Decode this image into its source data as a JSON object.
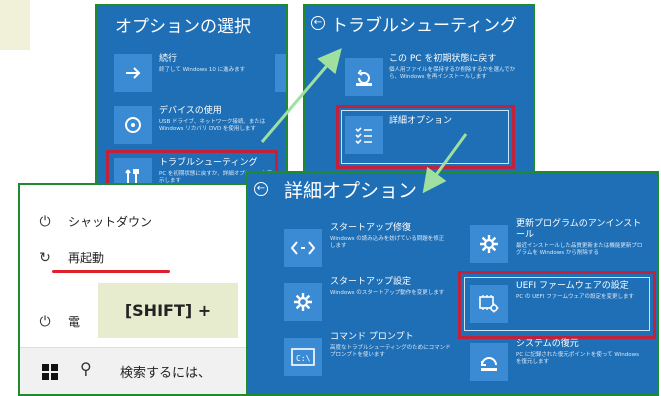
{
  "panel_options": {
    "title": "オプションの選択",
    "items": [
      {
        "label": "続行",
        "desc": "終了して Windows 10 に進みます",
        "icon": "arrow-right-icon"
      },
      {
        "label": "デバイスの使用",
        "desc": "USB ドライブ、ネットワーク接続、または Windows リカバリ DVD を使用します",
        "icon": "disc-icon"
      },
      {
        "label": "トラブルシューティング",
        "desc": "PC を初期状態に戻すか、詳細オプションを表示します",
        "icon": "tools-icon"
      }
    ]
  },
  "panel_troubleshoot": {
    "title": "トラブルシューティング",
    "items": [
      {
        "label": "この PC を初期状態に戻す",
        "desc": "個人用ファイルを保持するか削除するかを選んでから、Windows を再インストールします",
        "icon": "reset-icon"
      },
      {
        "label": "詳細オプション",
        "desc": "",
        "icon": "checklist-icon"
      }
    ]
  },
  "panel_advanced": {
    "title": "詳細オプション",
    "left": [
      {
        "label": "スタートアップ修復",
        "desc": "Windows の読み込みを妨げている問題を修正します",
        "icon": "code-icon"
      },
      {
        "label": "スタートアップ設定",
        "desc": "Windows のスタートアップ動作を変更します",
        "icon": "gear-icon"
      },
      {
        "label": "コマンド プロンプト",
        "desc": "高度なトラブルシューティングのためにコマンド プロンプトを使います",
        "icon": "cmd-icon"
      }
    ],
    "right": [
      {
        "label": "更新プログラムのアンインストール",
        "desc": "最近インストールした品質更新または機能更新プログラムを Windows から削除する",
        "icon": "gear-icon"
      },
      {
        "label": "UEFI ファームウェアの設定",
        "desc": "PC の UEFI ファームウェアの設定を変更します",
        "icon": "chip-gear-icon"
      },
      {
        "label": "システムの復元",
        "desc": "PC に記録された復元ポイントを使って Windows を復元します",
        "icon": "restore-icon"
      }
    ]
  },
  "start_menu": {
    "shutdown_label": "シャットダウン",
    "restart_label": "再起動",
    "power_label": "電",
    "search_placeholder": "検索するには、"
  },
  "shift_label": "[SHIFT] +",
  "colors": {
    "panel_blue": "#1e6fb6",
    "tile_blue": "#3a8bd3",
    "frame_green": "#1f8b2e",
    "highlight_red": "#c0223b",
    "arrow_green": "#9fe0a0",
    "underline_red": "#e0202a"
  }
}
